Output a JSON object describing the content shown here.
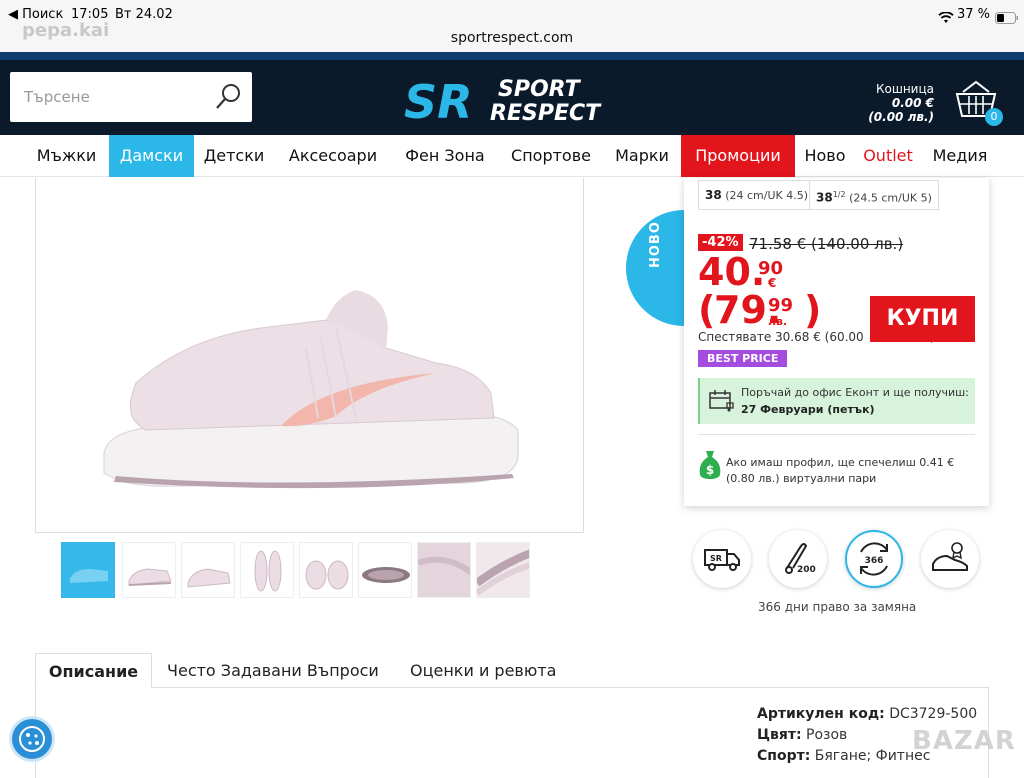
{
  "status_bar": {
    "back": "◀ Поиск",
    "time": "17:05",
    "date": "Вт 24.02",
    "battery": "37 %"
  },
  "watermark_top": "pepa.kai",
  "url": "sportrespect.com",
  "header": {
    "search_placeholder": "Търсене",
    "logo_line1": "SPORT",
    "logo_line2": "RESPECT",
    "logo_mark": "SR",
    "cart_label": "Кошница",
    "cart_eur": "0.00 €",
    "cart_bgn": "(0.00 лв.)",
    "cart_count": "0"
  },
  "nav": [
    {
      "label": "Мъжки",
      "active": false
    },
    {
      "label": "Дамски",
      "active": true
    },
    {
      "label": "Детски",
      "active": false
    },
    {
      "label": "Аксесоари",
      "active": false
    },
    {
      "label": "Фен Зона",
      "active": false
    },
    {
      "label": "Спортове",
      "active": false
    },
    {
      "label": "Марки",
      "active": false
    },
    {
      "label": "Промоции",
      "active": false,
      "highlight": true
    },
    {
      "label": "Ново",
      "active": false
    },
    {
      "label": "Outlet",
      "active": false,
      "red_text": true
    },
    {
      "label": "Медия",
      "active": false
    }
  ],
  "colors": {
    "accent_blue": "#2bb7e8",
    "promo_red": "#e2151d",
    "header_bg": "#0b1a2b",
    "best_price": "#a44be0"
  },
  "badge_new": "НОВО",
  "sizes": [
    {
      "size": "38",
      "detail": "(24 cm/UK 4.5)"
    },
    {
      "size": "38",
      "sup": "1/2",
      "detail": "(24.5 cm/UK 5)"
    }
  ],
  "price": {
    "discount": "-42%",
    "old": "71.58 € (140.00 лв.)",
    "eur_int": "40.",
    "eur_dec": "90",
    "eur_sym": "€",
    "bgn_open": "(",
    "bgn_int": "79.",
    "bgn_dec": "99",
    "bgn_sym": "лв.",
    "bgn_close": ")",
    "save": "Спестявате 30.68 € (60.00",
    "save_tail": ")"
  },
  "buy_label": "КУПИ",
  "best_price": "BEST PRICE",
  "delivery": {
    "line1": "Поръчай до офис Еконт и ще получиш:",
    "line2": "27 Февруари (петък)"
  },
  "virtual_money": "Ако имаш профил, ще спечелиш 0.41 € (0.80 лв.) виртуални пари",
  "features": {
    "icon_200": "200",
    "icon_366": "366",
    "label": "366 дни право за замяна"
  },
  "tabs": [
    "Описание",
    "Често Задавани Въпроси",
    "Оценки и ревюта"
  ],
  "specs": [
    {
      "key": "Артикулен код:",
      "value": "DC3729-500"
    },
    {
      "key": "Цвят:",
      "value": "Розов"
    },
    {
      "key": "Спорт:",
      "value": "Бягане; Фитнес"
    }
  ],
  "watermark_bottom": "BAZAR"
}
